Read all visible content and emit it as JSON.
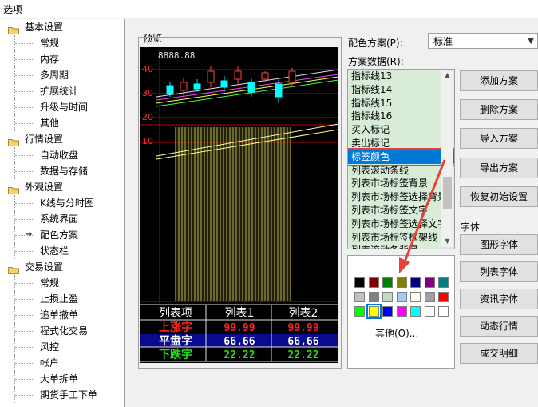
{
  "window": {
    "title": "选项"
  },
  "tree": [
    {
      "label": "基本设置",
      "type": "category"
    },
    {
      "label": "常规",
      "type": "item"
    },
    {
      "label": "内存",
      "type": "item"
    },
    {
      "label": "多周期",
      "type": "item"
    },
    {
      "label": "扩展统计",
      "type": "item"
    },
    {
      "label": "升级与时间",
      "type": "item"
    },
    {
      "label": "其他",
      "type": "item"
    },
    {
      "label": "行情设置",
      "type": "category"
    },
    {
      "label": "自动收盘",
      "type": "item"
    },
    {
      "label": "数据与存储",
      "type": "item"
    },
    {
      "label": "外观设置",
      "type": "category"
    },
    {
      "label": "K线与分时图",
      "type": "item"
    },
    {
      "label": "系统界面",
      "type": "item"
    },
    {
      "label": "配色方案",
      "type": "item",
      "selected": true
    },
    {
      "label": "状态栏",
      "type": "item"
    },
    {
      "label": "交易设置",
      "type": "category"
    },
    {
      "label": "常规",
      "type": "item"
    },
    {
      "label": "止损止盈",
      "type": "item"
    },
    {
      "label": "追单撤单",
      "type": "item"
    },
    {
      "label": "程式化交易",
      "type": "item"
    },
    {
      "label": "风控",
      "type": "item"
    },
    {
      "label": "帐户",
      "type": "item"
    },
    {
      "label": "大单拆单",
      "type": "item"
    },
    {
      "label": "期货手工下单",
      "type": "item"
    }
  ],
  "preview": {
    "label": "预览",
    "price_readout": "8888.88",
    "axis_labels": [
      "40",
      "30",
      "20",
      "10"
    ],
    "table": {
      "headers": [
        "列表项",
        "列表1",
        "列表2"
      ],
      "rows": [
        {
          "label": "上涨字",
          "v1": "99.99",
          "v2": "99.99",
          "color": "#ff2020"
        },
        {
          "label": "平盘字",
          "v1": "66.66",
          "v2": "66.66",
          "color": "#ffffff"
        },
        {
          "label": "下跌字",
          "v1": "22.22",
          "v2": "22.22",
          "color": "#20e020"
        }
      ]
    }
  },
  "scheme": {
    "label": "配色方案(P):",
    "value": "标准",
    "data_label": "方案数据(R):"
  },
  "list_items": [
    "指标线13",
    "指标线14",
    "指标线15",
    "指标线16",
    "买入标记",
    "卖出标记",
    "标签颜色",
    "列表滚动条线",
    "列表市场标签背景",
    "列表市场标签选择背景",
    "列表市场标签文字",
    "列表市场标签选择文字",
    "列表市场标签框架线",
    "列表滚动条背景"
  ],
  "selected_item": "标签颜色",
  "palette": {
    "colors": [
      "#000000",
      "#800000",
      "#008000",
      "#808000",
      "#000080",
      "#800080",
      "#008080",
      "#c0c0c0",
      "#808080",
      "#c0dcc0",
      "#a6caf0",
      "#fffbf0",
      "#a0a0a4",
      "#ff0000",
      "#00ff00",
      "#ffff00",
      "#0000ff",
      "#ff00ff",
      "#00ffff",
      "#ffffff",
      "#ffffff"
    ],
    "selected_color": "#ffff00",
    "other_label": "其他(O)..."
  },
  "buttons": {
    "add": "添加方案",
    "delete": "删除方案",
    "import": "导入方案",
    "export": "导出方案",
    "restore": "恢复初始设置",
    "font_section": "字体",
    "graph_font": "图形字体",
    "list_font": "列表字体",
    "info_font": "资讯字体",
    "dynamic_font": "动态行情",
    "trade_detail": "成交明细"
  }
}
